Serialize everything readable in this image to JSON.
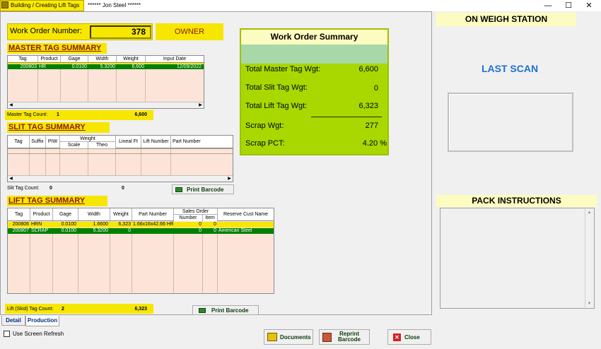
{
  "window": {
    "tab_title": "Building / Creating Lift Tags",
    "user": "****** Jon Steel ******"
  },
  "work_order": {
    "label": "Work Order Number:",
    "value": "378",
    "owner": "OWNER"
  },
  "master": {
    "title": "MASTER TAG SUMMARY",
    "columns": [
      "Tag",
      "Product",
      "Gage",
      "Width",
      "Weight",
      "Input Date"
    ],
    "rows": [
      {
        "tag": "200803",
        "product": "HR",
        "gage": "0.0100",
        "width": "5.3200",
        "weight": "6,600",
        "date": "12/09/2022"
      }
    ],
    "count_label": "Master Tag Count:",
    "count": "1",
    "count_weight": "6,600"
  },
  "slit": {
    "title": "SLIT TAG SUMMARY",
    "columns": [
      "Tag",
      "Suffix",
      "PIW",
      "Weight",
      "Scale",
      "Theo",
      "Lineal Ft",
      "Lift Number",
      "Part Number"
    ],
    "count_label": "Slit Tag Count:",
    "count": "0",
    "count_weight": "0",
    "print_label": "Print Barcode"
  },
  "lift": {
    "title": "LIFT TAG SUMMARY",
    "columns": [
      "Tag",
      "Product",
      "Gage",
      "Width",
      "Weight",
      "Part Number",
      "Sales Order",
      "Number",
      "Item",
      "Reserve Cust Name"
    ],
    "rows": [
      {
        "tag": "200806",
        "product": "HRN",
        "gage": "0.0100",
        "width": "1.6600",
        "weight": "6,323",
        "part": "1.66x16x42.66 HR",
        "number": "0",
        "item": "0",
        "cust": ""
      },
      {
        "tag": "200807",
        "product": "SCRAP",
        "gage": "0.0100",
        "width": "5.3200",
        "weight": "0",
        "part": "",
        "number": "0",
        "item": "0",
        "cust": "American Steel"
      }
    ],
    "count_label": "Lift (Skid) Tag Count:",
    "count": "2",
    "count_weight": "6,323",
    "print_label": "Print Barcode"
  },
  "summary": {
    "title": "Work Order Summary",
    "items": [
      {
        "label": "Total Master Tag Wgt:",
        "value": "6,600"
      },
      {
        "label": "Total Slit Tag Wgt:",
        "value": "0"
      },
      {
        "label": "Total Lift Tag Wgt:",
        "value": "6,323"
      },
      {
        "label": "Scrap Wgt:",
        "value": "277"
      },
      {
        "label": "Scrap PCT:",
        "value": "4.20 %"
      }
    ]
  },
  "right": {
    "station": "ON WEIGH STATION",
    "last_scan": "LAST SCAN",
    "pack": "PACK INSTRUCTIONS"
  },
  "tabs": {
    "detail": "Detail",
    "production": "Production"
  },
  "refresh_label": "Use Screen Refresh",
  "buttons": {
    "documents": "Documents",
    "reprint": "Reprint Barcode",
    "close": "Close"
  }
}
